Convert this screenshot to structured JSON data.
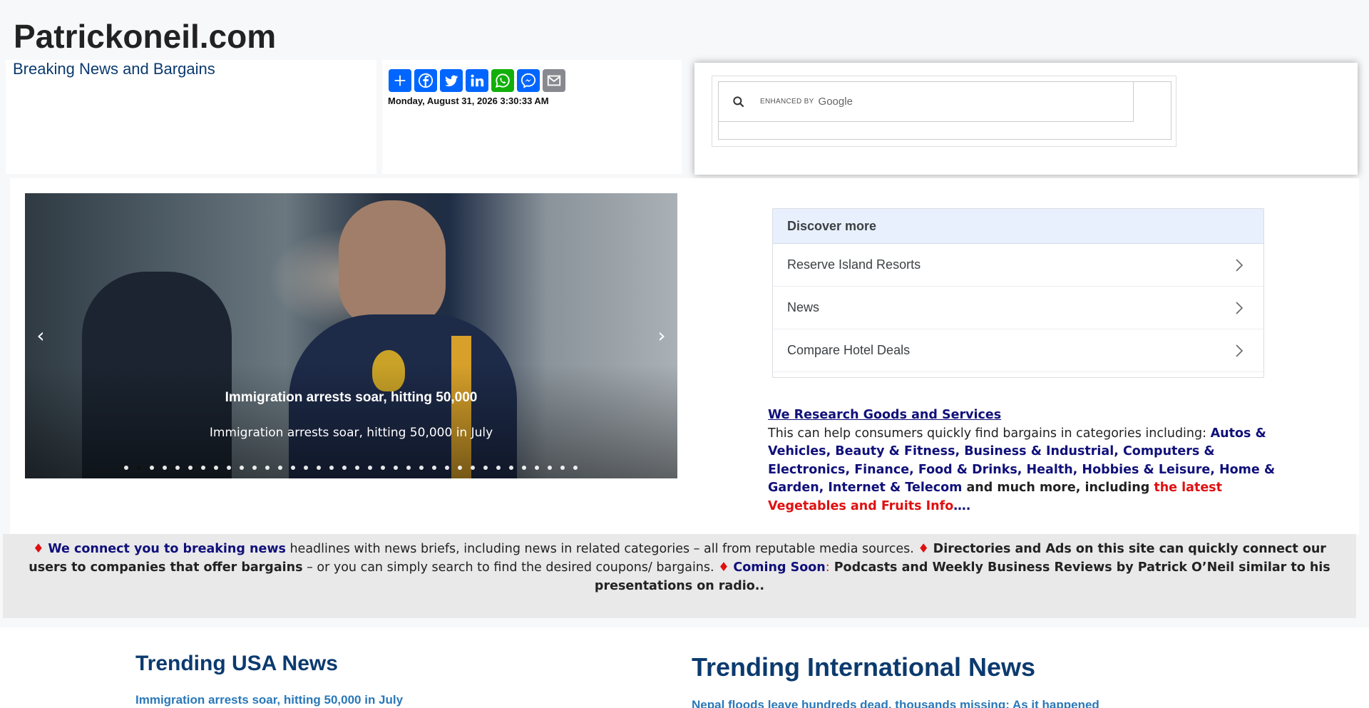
{
  "site": {
    "title": "Patrickoneil.com",
    "tagline": "Breaking News and Bargains"
  },
  "share": {
    "buttons": [
      "plus-icon",
      "facebook-icon",
      "twitter-icon",
      "linkedin-icon",
      "whatsapp-icon",
      "messenger-icon",
      "email-icon"
    ]
  },
  "datetime": "Monday, August 31, 2026 3:30:33 AM",
  "search": {
    "enhanced_by": "ENHANCED BY",
    "provider": "Google"
  },
  "carousel": {
    "caption_title": "Immigration arrests soar, hitting 50,000",
    "caption_text": "Immigration arrests soar, hitting 50,000 in July",
    "slide_count": 36,
    "active_slide": 2,
    "prev_label": "‹",
    "next_label": "›"
  },
  "discover": {
    "heading": "Discover more",
    "items": [
      {
        "label": "Reserve Island Resorts"
      },
      {
        "label": "News"
      },
      {
        "label": "Compare Hotel Deals"
      }
    ]
  },
  "research": {
    "heading": "We Research Goods and Services",
    "intro": "This can help consumers quickly find bargains in categories including: ",
    "categories": "Autos & Vehicles, Beauty & Fitness, Business & Industrial, Computers & Electronics, Finance, Food & Drinks, Health, Hobbies & Leisure, Home & Garden, Internet & Telecom",
    "more": " and much more, including ",
    "highlight": "the latest Vegetables and Fruits Info",
    "ellipsis": "…."
  },
  "banner": {
    "diamond": "♦",
    "connect": "We connect you to breaking news",
    "headlines": " headlines with news briefs, including news in related categories – all from reputable media sources. ",
    "directories": " Directories and Ads on this site can quickly connect our users to companies that offer bargains",
    "search_text": " – or you can simply search to find the desired coupons/ bargains. ",
    "coming_soon": "Coming Soon",
    "colon": ":",
    "podcasts": " Podcasts and Weekly Business Reviews by Patrick O’Neil similar to his presentations on radio.."
  },
  "trending": {
    "usa_title": "Trending USA News",
    "usa_first": "Immigration arrests soar, hitting 50,000 in July",
    "intl_title": "Trending International News",
    "intl_first": "Nepal floods leave hundreds dead, thousands missing: As it happened"
  }
}
